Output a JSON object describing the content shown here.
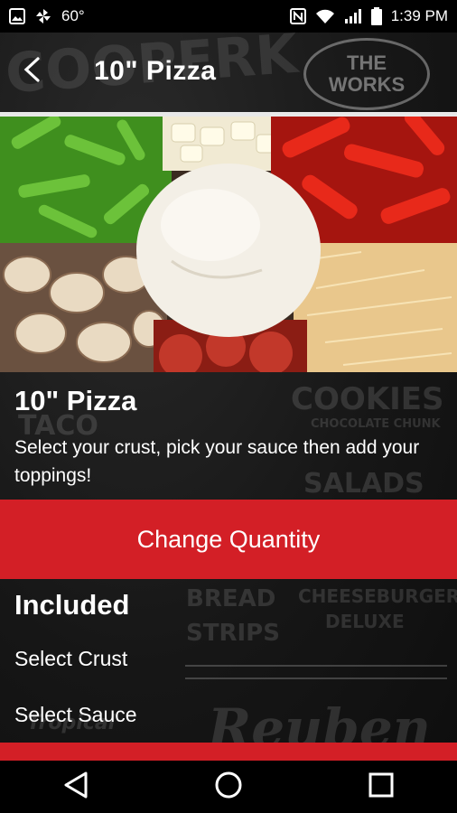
{
  "status_bar": {
    "temperature": "60°",
    "time": "1:39 PM",
    "icons": [
      "image-icon",
      "pinwheel-icon",
      "nfc-icon",
      "wifi-icon",
      "signal-icon",
      "battery-icon"
    ]
  },
  "app_bar": {
    "title": "10\" Pizza",
    "back_icon": "back-arrow-icon"
  },
  "background_art": {
    "badge_line1": "THE",
    "badge_line2": "WORKS",
    "words": [
      "COOKIES",
      "CHOCOLATE CHUNK",
      "SALADS",
      "CHEESEBURGER",
      "DELUXE",
      "BREAD",
      "STRIPS",
      "Reuben",
      "Tropical",
      "TACO"
    ]
  },
  "item": {
    "title": "10\" Pizza",
    "description": "Select your crust, pick your sauce then add your toppings!"
  },
  "quantity_button": {
    "label": "Change Quantity"
  },
  "included": {
    "heading": "Included",
    "options": [
      {
        "label": "Select Crust"
      },
      {
        "label": "Select Sauce"
      }
    ]
  },
  "colors": {
    "accent_red": "#d31f26",
    "background": "#111111"
  },
  "nav_bar": {
    "icons": [
      "back-triangle-icon",
      "home-circle-icon",
      "recents-square-icon"
    ]
  }
}
